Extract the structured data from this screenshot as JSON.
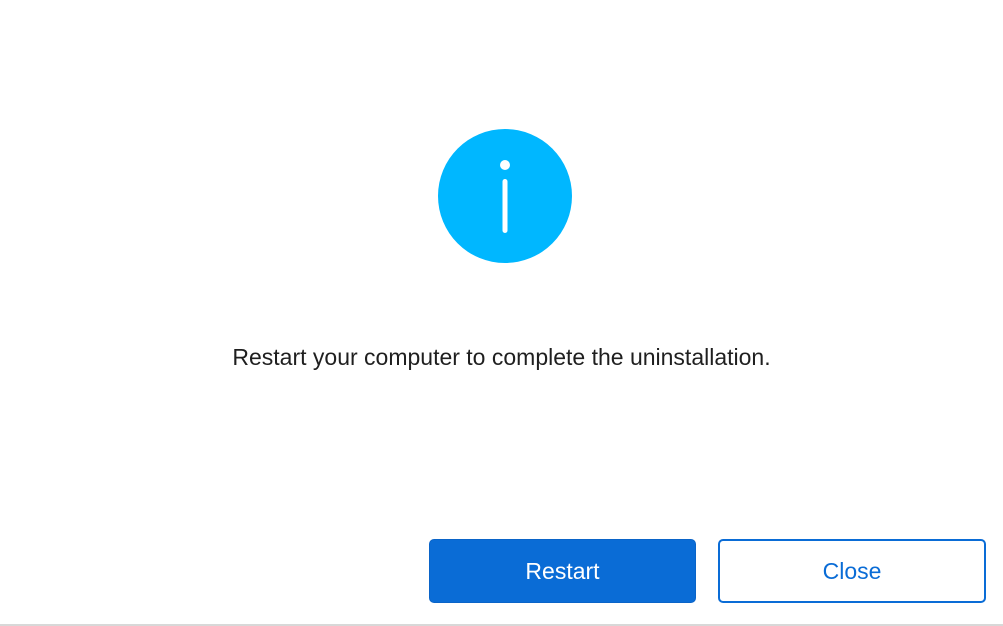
{
  "dialog": {
    "icon": "info-icon",
    "icon_color": "#00b7ff",
    "message": "Restart your computer to complete the uninstallation.",
    "primary_button_label": "Restart",
    "secondary_button_label": "Close",
    "accent_color": "#0a6cd6"
  }
}
